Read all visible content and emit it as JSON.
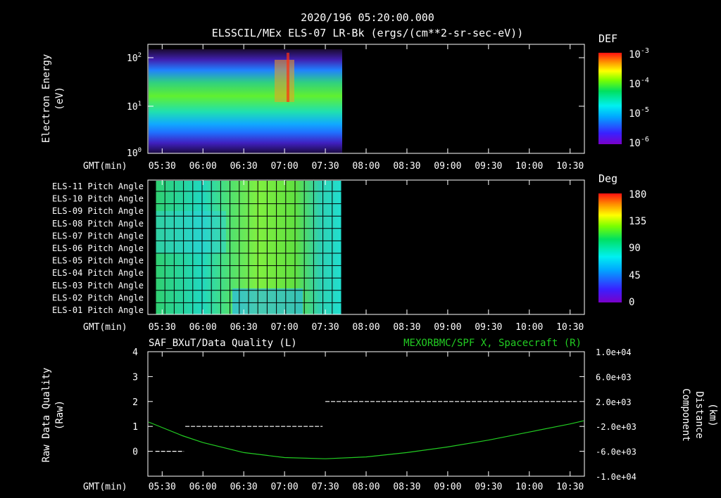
{
  "header": {
    "line1": "2020/196 05:20:00.000",
    "line2": "ELSSCIL/MEx ELS-07 LR-Bk  (ergs/(cm**2-sr-sec-eV))"
  },
  "time_axis": {
    "label": "GMT(min)",
    "ticks": [
      "05:30",
      "06:00",
      "06:30",
      "07:00",
      "07:30",
      "08:00",
      "08:30",
      "09:00",
      "09:30",
      "10:00",
      "10:30"
    ]
  },
  "chart_data": [
    {
      "type": "heatmap",
      "name": "spectrogram",
      "ylabel": "Electron Energy\n(eV)",
      "y_ticks": [
        {
          "label": "10",
          "exp": "2"
        },
        {
          "label": "10",
          "exp": "1"
        },
        {
          "label": "10",
          "exp": "0"
        }
      ],
      "y_scale": "log",
      "ylim": [
        1,
        160
      ],
      "colorbar": {
        "title": "DEF",
        "ticks": [
          {
            "label": "10",
            "exp": "-3"
          },
          {
            "label": "10",
            "exp": "-4"
          },
          {
            "label": "10",
            "exp": "-5"
          },
          {
            "label": "10",
            "exp": "-6"
          }
        ]
      },
      "data_extent_time": [
        "05:20",
        "07:45"
      ]
    },
    {
      "type": "heatmap",
      "name": "pitch-angle",
      "row_labels": [
        "ELS-11 Pitch Angle",
        "ELS-10 Pitch Angle",
        "ELS-09 Pitch Angle",
        "ELS-08 Pitch Angle",
        "ELS-07 Pitch Angle",
        "ELS-06 Pitch Angle",
        "ELS-05 Pitch Angle",
        "ELS-04 Pitch Angle",
        "ELS-03 Pitch Angle",
        "ELS-02 Pitch Angle",
        "ELS-01 Pitch Angle"
      ],
      "colorbar": {
        "title": "Deg",
        "ticks": [
          "180",
          "135",
          "90",
          "45",
          "0"
        ]
      },
      "data_extent_time": [
        "05:25",
        "07:45"
      ]
    },
    {
      "type": "line",
      "name": "quality-and-position",
      "left_title": "SAF_BXuT/Data Quality (L)",
      "right_title": "MEXORBMC/SPF X, Spacecraft (R)",
      "ylabel": "Raw Data Quality\n(Raw)",
      "y2label": "Component\nDistance\n(km)",
      "ylim": [
        -1,
        4
      ],
      "y_ticks": [
        "4",
        "3",
        "2",
        "1",
        "0"
      ],
      "y2_ticks": [
        "1.0e+04",
        "6.0e+03",
        "2.0e+03",
        "-2.0e+03",
        "-6.0e+03",
        "-1.0e+04"
      ],
      "y2lim": [
        -10000,
        10000
      ],
      "xlim": [
        "05:20",
        "10:40"
      ],
      "series": [
        {
          "name": "SAF_BXuT/Data Quality",
          "color": "#ffffff",
          "dashed": true,
          "segments": [
            {
              "x": [
                "05:25",
                "05:46"
              ],
              "y": 0
            },
            {
              "x": [
                "05:47",
                "07:28"
              ],
              "y": 1
            },
            {
              "x": [
                "07:30",
                "10:35"
              ],
              "y": 2
            }
          ]
        },
        {
          "name": "MEXORBMC/SPF X, Spacecraft",
          "color": "#22cc22",
          "axis": "right",
          "x": [
            "05:20",
            "05:45",
            "06:00",
            "06:30",
            "07:00",
            "07:30",
            "08:00",
            "08:30",
            "09:00",
            "09:30",
            "10:00",
            "10:30",
            "10:40"
          ],
          "y": [
            -1300,
            -3500,
            -4600,
            -6200,
            -7000,
            -7200,
            -6900,
            -6200,
            -5300,
            -4200,
            -2900,
            -1600,
            -1100
          ]
        }
      ]
    }
  ]
}
